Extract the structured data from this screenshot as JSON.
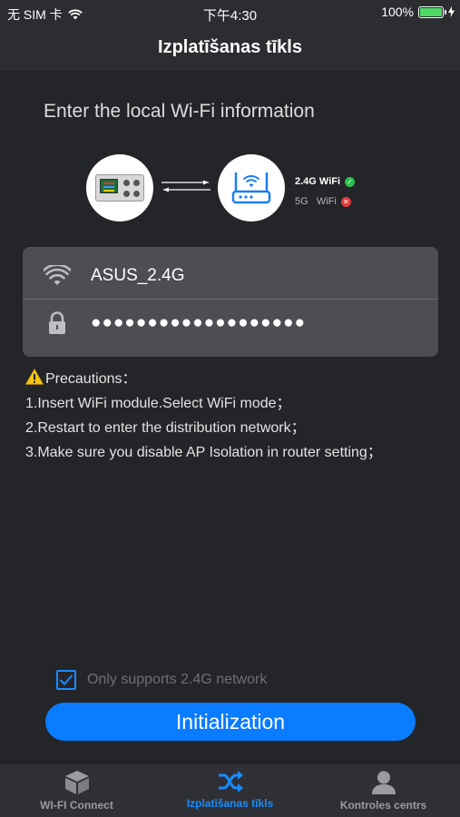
{
  "status_bar": {
    "carrier": "无 SIM 卡",
    "time": "下午4:30",
    "battery": "100%",
    "battery_level": 1.0
  },
  "nav": {
    "title": "Izplatīšanas tīkls"
  },
  "heading": "Enter the local Wi-Fi information",
  "wifi_status": {
    "band_24_label": "2.4G WiFi",
    "band_24_supported": true,
    "band_5_label": "5G   WiFi",
    "band_5_supported": false
  },
  "form": {
    "ssid": "ASUS_2.4G",
    "password_masked": "●●●●●●●●●●●●●●●●●●●",
    "ssid_icon": "wifi-icon",
    "password_icon": "lock-icon"
  },
  "precautions": {
    "title": "Precautions：",
    "items": [
      "1.Insert WiFi module.Select WiFi mode；",
      "2.Restart to enter the distribution network；",
      "3.Make sure you disable AP Isolation in router setting；"
    ]
  },
  "checkbox": {
    "label": "Only supports 2.4G network",
    "checked": true
  },
  "init_button": {
    "label": "Initialization"
  },
  "tabs": [
    {
      "label": "WI-FI Connect",
      "icon": "cube-icon",
      "active": false
    },
    {
      "label": "Izplatīšanas tīkls",
      "icon": "shuffle-icon",
      "active": true
    },
    {
      "label": "Kontroles centrs",
      "icon": "user-icon",
      "active": false
    }
  ],
  "colors": {
    "accent": "#0a7cff",
    "background": "#232529",
    "card": "#4c4e53",
    "success": "#28c24a",
    "error": "#e23b3b"
  }
}
